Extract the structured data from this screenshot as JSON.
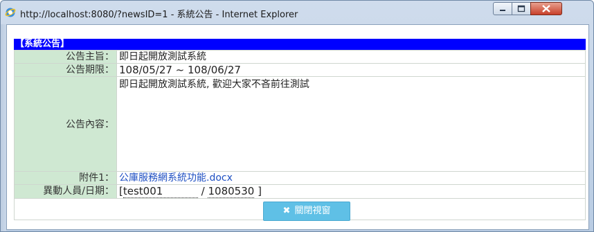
{
  "window": {
    "title": "http://localhost:8080/?newsID=1 - 系統公告 - Internet Explorer"
  },
  "notice": {
    "header": "【系統公告】",
    "rows": [
      {
        "label": "公告主旨：",
        "value": "即日起開放測試系統"
      },
      {
        "label": "公告期限：",
        "value": "108/05/27 ~ 108/06/27"
      },
      {
        "label": "公告內容：",
        "value": "即日起開放測試系統, 歡迎大家不吝前往測試"
      },
      {
        "label": "附件1：",
        "value": "公庫服務網系統功能.docx"
      }
    ],
    "modifier": {
      "label": "異動人員/日期：",
      "open": "[",
      "user": "test001",
      "sep": "/",
      "date": "1080530",
      "close": "]"
    }
  },
  "close_button": {
    "icon_glyph": "✖",
    "label": "關閉視窗"
  }
}
